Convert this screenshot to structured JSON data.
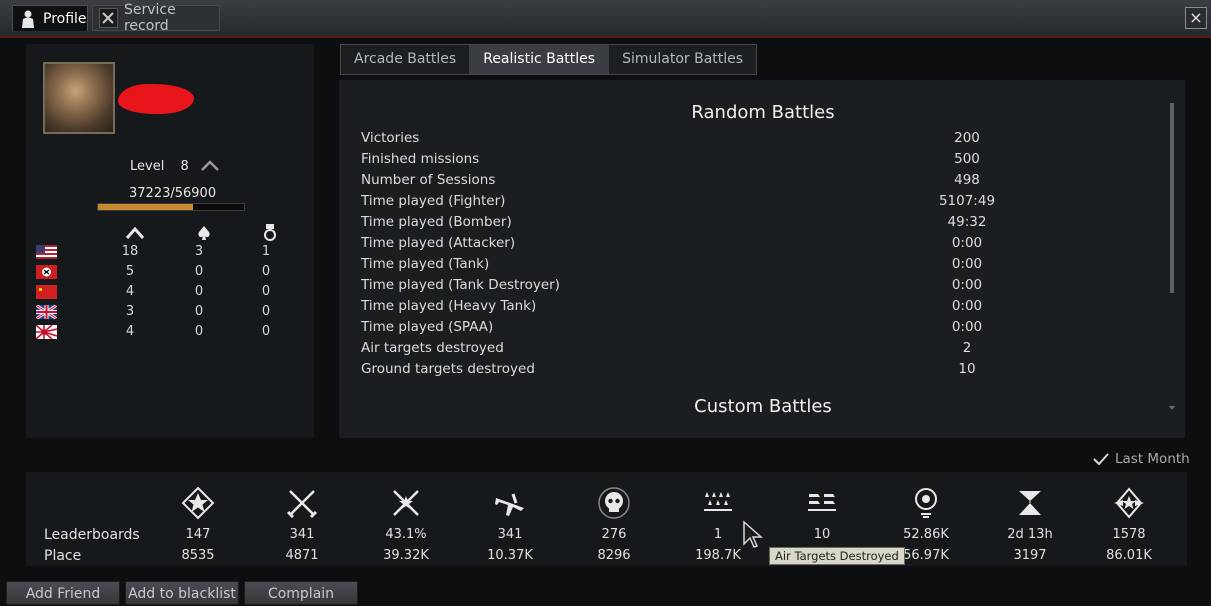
{
  "window": {
    "tabs": [
      {
        "label": "Profile",
        "icon": "person-icon"
      },
      {
        "label": "Service record",
        "icon": "crossed-wrench-icon"
      }
    ],
    "close_label": "×"
  },
  "profile": {
    "level_label": "Level",
    "level": "8",
    "xp": "37223/56900",
    "xp_progress": 0.654,
    "countries": [
      {
        "flag": "usa-flag",
        "vehicles": "18",
        "aces": "3",
        "medals": "1"
      },
      {
        "flag": "germany-flag",
        "vehicles": "5",
        "aces": "0",
        "medals": "0"
      },
      {
        "flag": "ussr-flag",
        "vehicles": "4",
        "aces": "0",
        "medals": "0"
      },
      {
        "flag": "britain-flag",
        "vehicles": "3",
        "aces": "0",
        "medals": "0"
      },
      {
        "flag": "japan-flag",
        "vehicles": "4",
        "aces": "0",
        "medals": "0"
      }
    ]
  },
  "battle_tabs": [
    "Arcade Battles",
    "Realistic Battles",
    "Simulator Battles"
  ],
  "active_battle_tab": 1,
  "random_battles": {
    "title": "Random Battles",
    "stats": [
      {
        "label": "Victories",
        "value": "200"
      },
      {
        "label": "Finished missions",
        "value": "500"
      },
      {
        "label": "Number of Sessions",
        "value": "498"
      },
      {
        "label": "Time played (Fighter)",
        "value": "5107:49"
      },
      {
        "label": "Time played (Bomber)",
        "value": "49:32"
      },
      {
        "label": "Time played (Attacker)",
        "value": "0:00"
      },
      {
        "label": "Time played (Tank)",
        "value": "0:00"
      },
      {
        "label": "Time played (Tank Destroyer)",
        "value": "0:00"
      },
      {
        "label": "Time played (Heavy Tank)",
        "value": "0:00"
      },
      {
        "label": "Time played (SPAA)",
        "value": "0:00"
      },
      {
        "label": "Air targets destroyed",
        "value": "2"
      },
      {
        "label": "Ground targets destroyed",
        "value": "10"
      }
    ]
  },
  "custom_battles": {
    "title": "Custom Battles"
  },
  "last_month_label": "Last Month",
  "leaderboards": {
    "row1_label": "Leaderboards",
    "row2_label": "Place",
    "columns": [
      {
        "icon": "star-badge-icon",
        "value": "147",
        "place": "8535"
      },
      {
        "icon": "crossed-swords-icon",
        "value": "341",
        "place": "4871"
      },
      {
        "icon": "crossed-swords-star-icon",
        "value": "43.1%",
        "place": "39.32K"
      },
      {
        "icon": "airplane-icon",
        "value": "341",
        "place": "10.37K"
      },
      {
        "icon": "skull-icon",
        "value": "276",
        "place": "8296"
      },
      {
        "icon": "air-targets-icon",
        "value": "1",
        "place": "198.7K"
      },
      {
        "icon": "ground-targets-icon",
        "value": "10",
        "place": ""
      },
      {
        "icon": "lightbulb-icon",
        "value": "52.86K",
        "place": "56.97K"
      },
      {
        "icon": "flag-badge-icon",
        "value": "2d 13h",
        "place": "3197"
      },
      {
        "icon": "winged-badge-icon",
        "value": "1578",
        "place": "86.01K"
      }
    ]
  },
  "tooltip": "Air Targets Destroyed",
  "bottom_buttons": [
    "Add Friend",
    "Add to blacklist",
    "Complain"
  ]
}
